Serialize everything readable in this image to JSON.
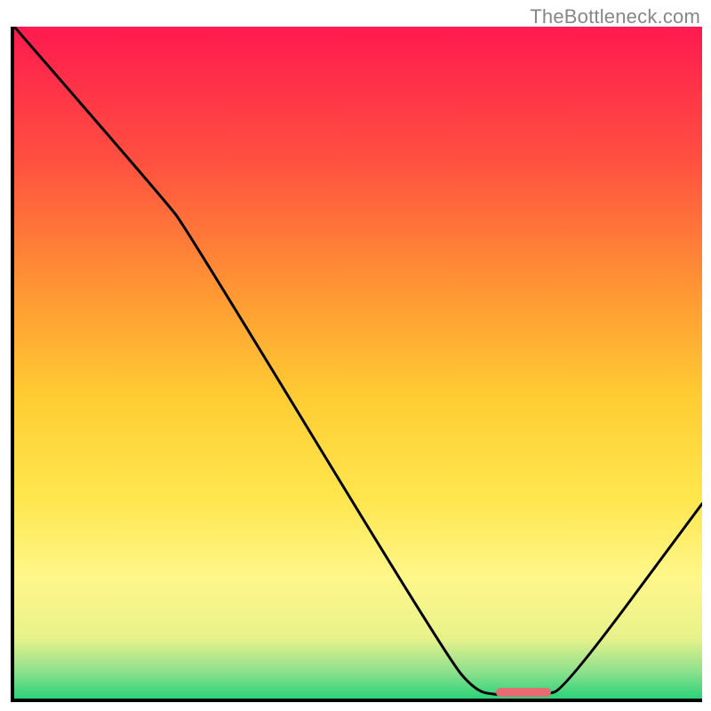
{
  "watermark": "TheBottleneck.com",
  "chart_data": {
    "type": "line",
    "title": "",
    "xlabel": "",
    "ylabel": "",
    "xlim": [
      0,
      100
    ],
    "ylim": [
      0,
      100
    ],
    "gradient": {
      "stops": [
        {
          "offset": 0,
          "color": "#ff1a4f"
        },
        {
          "offset": 20,
          "color": "#ff5040"
        },
        {
          "offset": 40,
          "color": "#ff9933"
        },
        {
          "offset": 55,
          "color": "#ffcc33"
        },
        {
          "offset": 70,
          "color": "#ffe64d"
        },
        {
          "offset": 82,
          "color": "#fff78a"
        },
        {
          "offset": 91,
          "color": "#e8f28a"
        },
        {
          "offset": 96,
          "color": "#8de08d"
        },
        {
          "offset": 100,
          "color": "#2bd37a"
        }
      ]
    },
    "series": [
      {
        "name": "curve",
        "points": [
          {
            "x": 0,
            "y": 100
          },
          {
            "x": 22,
            "y": 74
          },
          {
            "x": 25,
            "y": 70
          },
          {
            "x": 63,
            "y": 6
          },
          {
            "x": 67,
            "y": 1.2
          },
          {
            "x": 70,
            "y": 0.5
          },
          {
            "x": 77,
            "y": 0.5
          },
          {
            "x": 80,
            "y": 1.4
          },
          {
            "x": 100,
            "y": 29
          }
        ]
      }
    ],
    "marker": {
      "x_start": 70,
      "x_end": 78,
      "y": 0.9,
      "color": "#e66b73"
    }
  }
}
